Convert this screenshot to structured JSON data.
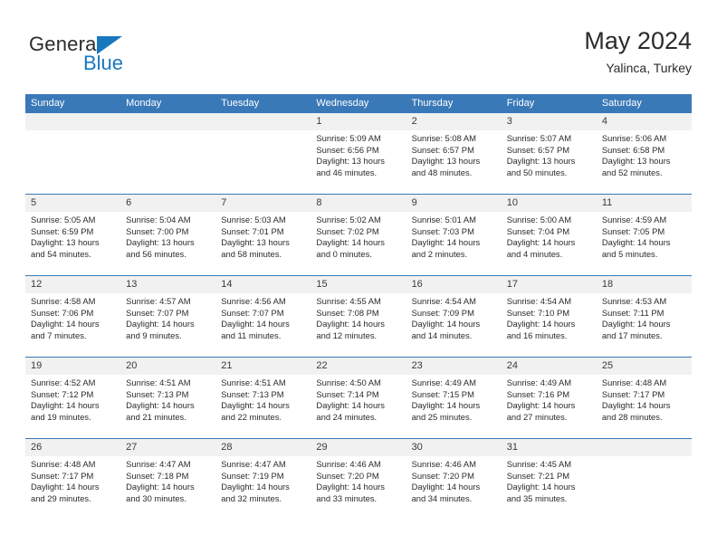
{
  "brand": {
    "name_top": "General",
    "name_bottom": "Blue",
    "triangle_color": "#1878be",
    "text_color": "#2b2b2b"
  },
  "header": {
    "title": "May 2024",
    "subtitle": "Yalinca, Turkey"
  },
  "theme": {
    "header_blue": "#3a79b8",
    "day_band_gray": "#f1f1f1",
    "cell_white": "#ffffff",
    "text": "#2b2b2b"
  },
  "labels": {
    "sunrise_prefix": "Sunrise:",
    "sunset_prefix": "Sunset:",
    "daylight_prefix": "Daylight:"
  },
  "weekdays": [
    "Sunday",
    "Monday",
    "Tuesday",
    "Wednesday",
    "Thursday",
    "Friday",
    "Saturday"
  ],
  "weeks": [
    [
      {
        "day": "",
        "sunrise": "",
        "sunset": "",
        "daylight_line1": "",
        "daylight_line2": ""
      },
      {
        "day": "",
        "sunrise": "",
        "sunset": "",
        "daylight_line1": "",
        "daylight_line2": ""
      },
      {
        "day": "",
        "sunrise": "",
        "sunset": "",
        "daylight_line1": "",
        "daylight_line2": ""
      },
      {
        "day": "1",
        "sunrise": "Sunrise: 5:09 AM",
        "sunset": "Sunset: 6:56 PM",
        "daylight_line1": "Daylight: 13 hours",
        "daylight_line2": "and 46 minutes."
      },
      {
        "day": "2",
        "sunrise": "Sunrise: 5:08 AM",
        "sunset": "Sunset: 6:57 PM",
        "daylight_line1": "Daylight: 13 hours",
        "daylight_line2": "and 48 minutes."
      },
      {
        "day": "3",
        "sunrise": "Sunrise: 5:07 AM",
        "sunset": "Sunset: 6:57 PM",
        "daylight_line1": "Daylight: 13 hours",
        "daylight_line2": "and 50 minutes."
      },
      {
        "day": "4",
        "sunrise": "Sunrise: 5:06 AM",
        "sunset": "Sunset: 6:58 PM",
        "daylight_line1": "Daylight: 13 hours",
        "daylight_line2": "and 52 minutes."
      }
    ],
    [
      {
        "day": "5",
        "sunrise": "Sunrise: 5:05 AM",
        "sunset": "Sunset: 6:59 PM",
        "daylight_line1": "Daylight: 13 hours",
        "daylight_line2": "and 54 minutes."
      },
      {
        "day": "6",
        "sunrise": "Sunrise: 5:04 AM",
        "sunset": "Sunset: 7:00 PM",
        "daylight_line1": "Daylight: 13 hours",
        "daylight_line2": "and 56 minutes."
      },
      {
        "day": "7",
        "sunrise": "Sunrise: 5:03 AM",
        "sunset": "Sunset: 7:01 PM",
        "daylight_line1": "Daylight: 13 hours",
        "daylight_line2": "and 58 minutes."
      },
      {
        "day": "8",
        "sunrise": "Sunrise: 5:02 AM",
        "sunset": "Sunset: 7:02 PM",
        "daylight_line1": "Daylight: 14 hours",
        "daylight_line2": "and 0 minutes."
      },
      {
        "day": "9",
        "sunrise": "Sunrise: 5:01 AM",
        "sunset": "Sunset: 7:03 PM",
        "daylight_line1": "Daylight: 14 hours",
        "daylight_line2": "and 2 minutes."
      },
      {
        "day": "10",
        "sunrise": "Sunrise: 5:00 AM",
        "sunset": "Sunset: 7:04 PM",
        "daylight_line1": "Daylight: 14 hours",
        "daylight_line2": "and 4 minutes."
      },
      {
        "day": "11",
        "sunrise": "Sunrise: 4:59 AM",
        "sunset": "Sunset: 7:05 PM",
        "daylight_line1": "Daylight: 14 hours",
        "daylight_line2": "and 5 minutes."
      }
    ],
    [
      {
        "day": "12",
        "sunrise": "Sunrise: 4:58 AM",
        "sunset": "Sunset: 7:06 PM",
        "daylight_line1": "Daylight: 14 hours",
        "daylight_line2": "and 7 minutes."
      },
      {
        "day": "13",
        "sunrise": "Sunrise: 4:57 AM",
        "sunset": "Sunset: 7:07 PM",
        "daylight_line1": "Daylight: 14 hours",
        "daylight_line2": "and 9 minutes."
      },
      {
        "day": "14",
        "sunrise": "Sunrise: 4:56 AM",
        "sunset": "Sunset: 7:07 PM",
        "daylight_line1": "Daylight: 14 hours",
        "daylight_line2": "and 11 minutes."
      },
      {
        "day": "15",
        "sunrise": "Sunrise: 4:55 AM",
        "sunset": "Sunset: 7:08 PM",
        "daylight_line1": "Daylight: 14 hours",
        "daylight_line2": "and 12 minutes."
      },
      {
        "day": "16",
        "sunrise": "Sunrise: 4:54 AM",
        "sunset": "Sunset: 7:09 PM",
        "daylight_line1": "Daylight: 14 hours",
        "daylight_line2": "and 14 minutes."
      },
      {
        "day": "17",
        "sunrise": "Sunrise: 4:54 AM",
        "sunset": "Sunset: 7:10 PM",
        "daylight_line1": "Daylight: 14 hours",
        "daylight_line2": "and 16 minutes."
      },
      {
        "day": "18",
        "sunrise": "Sunrise: 4:53 AM",
        "sunset": "Sunset: 7:11 PM",
        "daylight_line1": "Daylight: 14 hours",
        "daylight_line2": "and 17 minutes."
      }
    ],
    [
      {
        "day": "19",
        "sunrise": "Sunrise: 4:52 AM",
        "sunset": "Sunset: 7:12 PM",
        "daylight_line1": "Daylight: 14 hours",
        "daylight_line2": "and 19 minutes."
      },
      {
        "day": "20",
        "sunrise": "Sunrise: 4:51 AM",
        "sunset": "Sunset: 7:13 PM",
        "daylight_line1": "Daylight: 14 hours",
        "daylight_line2": "and 21 minutes."
      },
      {
        "day": "21",
        "sunrise": "Sunrise: 4:51 AM",
        "sunset": "Sunset: 7:13 PM",
        "daylight_line1": "Daylight: 14 hours",
        "daylight_line2": "and 22 minutes."
      },
      {
        "day": "22",
        "sunrise": "Sunrise: 4:50 AM",
        "sunset": "Sunset: 7:14 PM",
        "daylight_line1": "Daylight: 14 hours",
        "daylight_line2": "and 24 minutes."
      },
      {
        "day": "23",
        "sunrise": "Sunrise: 4:49 AM",
        "sunset": "Sunset: 7:15 PM",
        "daylight_line1": "Daylight: 14 hours",
        "daylight_line2": "and 25 minutes."
      },
      {
        "day": "24",
        "sunrise": "Sunrise: 4:49 AM",
        "sunset": "Sunset: 7:16 PM",
        "daylight_line1": "Daylight: 14 hours",
        "daylight_line2": "and 27 minutes."
      },
      {
        "day": "25",
        "sunrise": "Sunrise: 4:48 AM",
        "sunset": "Sunset: 7:17 PM",
        "daylight_line1": "Daylight: 14 hours",
        "daylight_line2": "and 28 minutes."
      }
    ],
    [
      {
        "day": "26",
        "sunrise": "Sunrise: 4:48 AM",
        "sunset": "Sunset: 7:17 PM",
        "daylight_line1": "Daylight: 14 hours",
        "daylight_line2": "and 29 minutes."
      },
      {
        "day": "27",
        "sunrise": "Sunrise: 4:47 AM",
        "sunset": "Sunset: 7:18 PM",
        "daylight_line1": "Daylight: 14 hours",
        "daylight_line2": "and 30 minutes."
      },
      {
        "day": "28",
        "sunrise": "Sunrise: 4:47 AM",
        "sunset": "Sunset: 7:19 PM",
        "daylight_line1": "Daylight: 14 hours",
        "daylight_line2": "and 32 minutes."
      },
      {
        "day": "29",
        "sunrise": "Sunrise: 4:46 AM",
        "sunset": "Sunset: 7:20 PM",
        "daylight_line1": "Daylight: 14 hours",
        "daylight_line2": "and 33 minutes."
      },
      {
        "day": "30",
        "sunrise": "Sunrise: 4:46 AM",
        "sunset": "Sunset: 7:20 PM",
        "daylight_line1": "Daylight: 14 hours",
        "daylight_line2": "and 34 minutes."
      },
      {
        "day": "31",
        "sunrise": "Sunrise: 4:45 AM",
        "sunset": "Sunset: 7:21 PM",
        "daylight_line1": "Daylight: 14 hours",
        "daylight_line2": "and 35 minutes."
      },
      {
        "day": "",
        "sunrise": "",
        "sunset": "",
        "daylight_line1": "",
        "daylight_line2": ""
      }
    ]
  ]
}
